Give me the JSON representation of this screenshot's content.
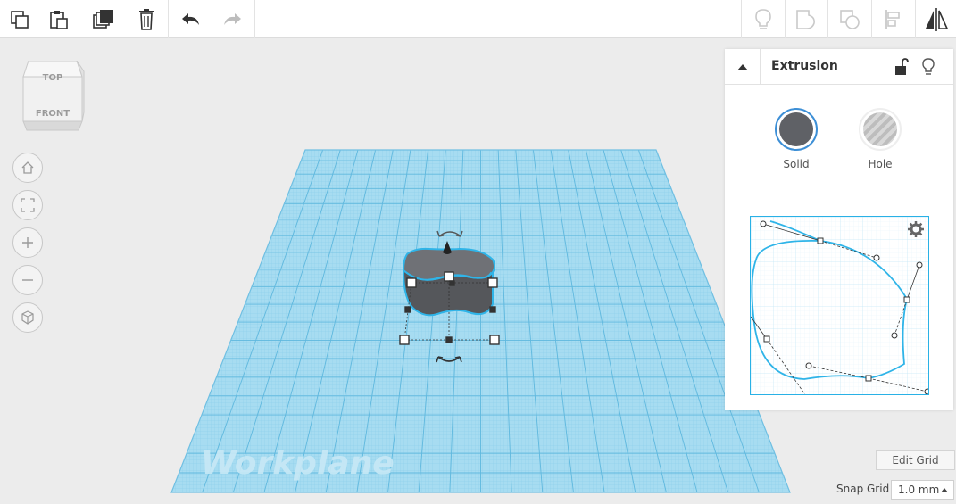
{
  "toolbar": {
    "left_tools": [
      {
        "name": "copy-icon"
      },
      {
        "name": "paste-icon"
      },
      {
        "name": "duplicate-icon"
      },
      {
        "name": "delete-icon"
      },
      {
        "name": "undo-icon"
      },
      {
        "name": "redo-icon"
      }
    ],
    "right_tools": [
      {
        "name": "bulb-icon"
      },
      {
        "name": "group-icon"
      },
      {
        "name": "ungroup-icon"
      },
      {
        "name": "align-icon"
      },
      {
        "name": "mirror-icon"
      }
    ]
  },
  "viewcube": {
    "top_label": "TOP",
    "front_label": "FRONT"
  },
  "nav_buttons": [
    "home-icon",
    "fit-view-icon",
    "zoom-in-icon",
    "zoom-out-icon",
    "perspective-icon"
  ],
  "workplane": {
    "label": "Workplane"
  },
  "shape_panel": {
    "title": "Extrusion",
    "materials": [
      {
        "label": "Solid",
        "color": "#5f6166"
      },
      {
        "label": "Hole",
        "color": "#c5c5c5"
      }
    ]
  },
  "grid_controls": {
    "edit_grid_label": "Edit Grid",
    "snap_grid_label": "Snap Grid",
    "snap_value": "1.0 mm"
  },
  "colors": {
    "accent": "#29b1e6",
    "workplane": "#9ad7ef",
    "shape": "#5f6166"
  }
}
